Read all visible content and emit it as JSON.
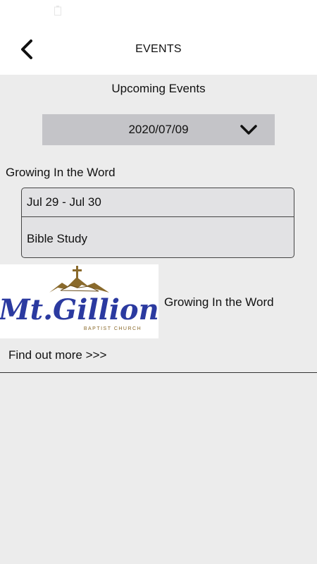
{
  "header": {
    "title": "EVENTS",
    "back_icon": "chevron-left-icon"
  },
  "events": {
    "section_title": "Upcoming Events",
    "selected_date": "2020/07/09",
    "dropdown_icon": "chevron-down-icon",
    "group_title": "Growing In the Word",
    "card": {
      "dates": "Jul 29 - Jul 30",
      "name": "Bible Study"
    }
  },
  "promo": {
    "logo_text": "Mt.Gillion",
    "logo_subtext": "BAPTIST CHURCH",
    "title": "Growing In the Word",
    "link_label": "Find out more >>>"
  },
  "colors": {
    "background": "#ececec",
    "header_bg": "#ffffff",
    "select_bg": "#c4c4c8",
    "card_bg": "#e2e2e4",
    "logo_blue": "#2b3aa0",
    "logo_gold": "#8a6a2c"
  }
}
